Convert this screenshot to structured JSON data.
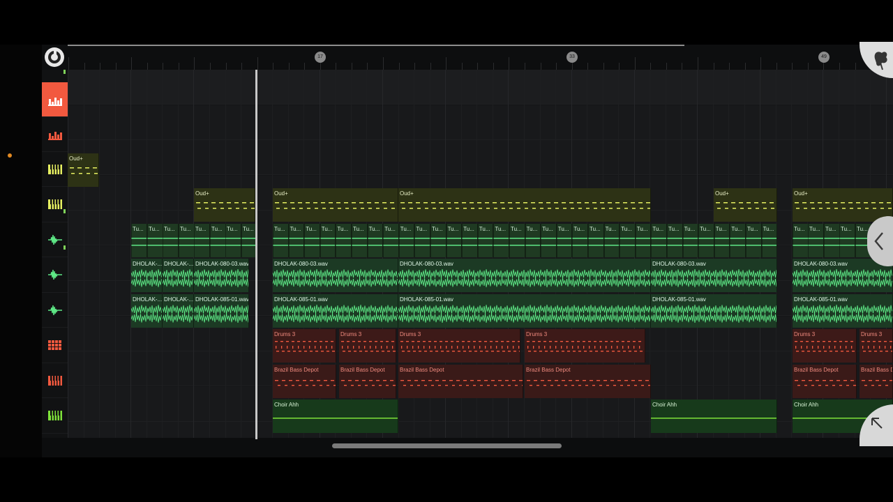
{
  "ruler": {
    "markers": [
      "17",
      "33",
      "49"
    ]
  },
  "tracks": [
    {
      "icon": "pattern-bars-icon",
      "color": "#ffffff"
    },
    {
      "icon": "pattern-bars-icon",
      "color": "#f2593f"
    },
    {
      "icon": "piano-keys-icon",
      "color": "#e6f061"
    },
    {
      "icon": "piano-keys-icon",
      "color": "#e6f061"
    },
    {
      "icon": "audio-wave-icon",
      "color": "#5ee886"
    },
    {
      "icon": "audio-wave-icon",
      "color": "#5ee886"
    },
    {
      "icon": "audio-wave-icon",
      "color": "#5ee886"
    },
    {
      "icon": "drum-pads-icon",
      "color": "#f2593f"
    },
    {
      "icon": "piano-keys-icon",
      "color": "#f2593f"
    },
    {
      "icon": "piano-keys-icon",
      "color": "#7ee23a"
    }
  ],
  "clip_names": {
    "oud": "Oud+",
    "tu": "Tu...",
    "dholak_short": "DHOLAK-...",
    "dholak_080": "DHOLAK-080-03.wav",
    "dholak_085": "DHOLAK-085-01.wav",
    "drums": "Drums 3",
    "bass": "Brazil Bass Depot",
    "choir": "Choir Ahh"
  },
  "colors": {
    "accent": "#f2593f",
    "oud": "#e6f061",
    "audio": "#5ee886",
    "drums": "#f2593f",
    "choir": "#7ee23a"
  }
}
